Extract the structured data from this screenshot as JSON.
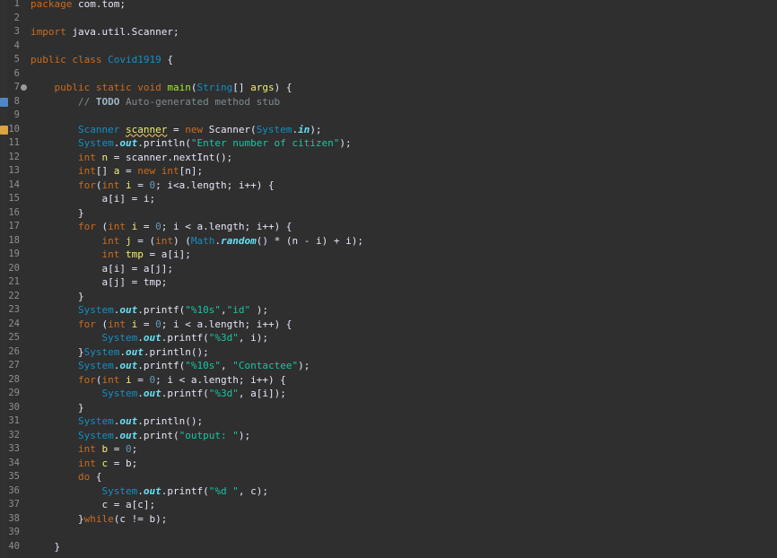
{
  "editor": {
    "language": "java",
    "lines": [
      {
        "n": "1",
        "tokens": [
          [
            "kw",
            "package"
          ],
          [
            "pln",
            " com.tom;"
          ]
        ]
      },
      {
        "n": "2",
        "tokens": []
      },
      {
        "n": "3",
        "tokens": [
          [
            "kw",
            "import"
          ],
          [
            "pln",
            " java.util.Scanner;"
          ]
        ]
      },
      {
        "n": "4",
        "tokens": []
      },
      {
        "n": "5",
        "tokens": [
          [
            "kw",
            "public"
          ],
          [
            "pln",
            " "
          ],
          [
            "kw",
            "class"
          ],
          [
            "pln",
            " "
          ],
          [
            "typ",
            "Covid1919"
          ],
          [
            "pln",
            " {"
          ]
        ]
      },
      {
        "n": "6",
        "tokens": []
      },
      {
        "n": "7",
        "tokens": [
          [
            "pln",
            "    "
          ],
          [
            "kw",
            "public"
          ],
          [
            "pln",
            " "
          ],
          [
            "kw",
            "static"
          ],
          [
            "pln",
            " "
          ],
          [
            "kw",
            "void"
          ],
          [
            "pln",
            " "
          ],
          [
            "mth",
            "main"
          ],
          [
            "pln",
            "("
          ],
          [
            "typ",
            "String"
          ],
          [
            "pln",
            "[] "
          ],
          [
            "var",
            "args"
          ],
          [
            "pln",
            ") {"
          ]
        ]
      },
      {
        "n": "8",
        "tokens": [
          [
            "pln",
            "        "
          ],
          [
            "cmt",
            "// "
          ],
          [
            "todo",
            "TODO"
          ],
          [
            "cmt",
            " Auto-generated method stub"
          ]
        ]
      },
      {
        "n": "9",
        "tokens": []
      },
      {
        "n": "10",
        "tokens": [
          [
            "pln",
            "        "
          ],
          [
            "typ",
            "Scanner"
          ],
          [
            "pln",
            " "
          ],
          [
            "warnvar",
            "scanner"
          ],
          [
            "pln",
            " = "
          ],
          [
            "kw",
            "new"
          ],
          [
            "pln",
            " Scanner("
          ],
          [
            "typ",
            "System"
          ],
          [
            "pln",
            "."
          ],
          [
            "fld",
            "in"
          ],
          [
            "pln",
            ");"
          ]
        ]
      },
      {
        "n": "11",
        "tokens": [
          [
            "pln",
            "        "
          ],
          [
            "typ",
            "System"
          ],
          [
            "pln",
            "."
          ],
          [
            "fld",
            "out"
          ],
          [
            "pln",
            ".println("
          ],
          [
            "str",
            "\"Enter number of citizen\""
          ],
          [
            "pln",
            ");"
          ]
        ]
      },
      {
        "n": "12",
        "tokens": [
          [
            "pln",
            "        "
          ],
          [
            "kw",
            "int"
          ],
          [
            "pln",
            " "
          ],
          [
            "var",
            "n"
          ],
          [
            "pln",
            " = scanner.nextInt();"
          ]
        ]
      },
      {
        "n": "13",
        "tokens": [
          [
            "pln",
            "        "
          ],
          [
            "kw",
            "int"
          ],
          [
            "pln",
            "[] "
          ],
          [
            "var",
            "a"
          ],
          [
            "pln",
            " = "
          ],
          [
            "kw",
            "new"
          ],
          [
            "pln",
            " "
          ],
          [
            "kw",
            "int"
          ],
          [
            "pln",
            "[n];"
          ]
        ]
      },
      {
        "n": "14",
        "tokens": [
          [
            "pln",
            "        "
          ],
          [
            "kw",
            "for"
          ],
          [
            "pln",
            "("
          ],
          [
            "kw",
            "int"
          ],
          [
            "pln",
            " "
          ],
          [
            "var",
            "i"
          ],
          [
            "pln",
            " = "
          ],
          [
            "num",
            "0"
          ],
          [
            "pln",
            "; i<a.length; i++) {"
          ]
        ]
      },
      {
        "n": "15",
        "tokens": [
          [
            "pln",
            "            a[i] = i;"
          ]
        ]
      },
      {
        "n": "16",
        "tokens": [
          [
            "pln",
            "        }"
          ]
        ]
      },
      {
        "n": "17",
        "tokens": [
          [
            "pln",
            "        "
          ],
          [
            "kw",
            "for"
          ],
          [
            "pln",
            " ("
          ],
          [
            "kw",
            "int"
          ],
          [
            "pln",
            " "
          ],
          [
            "var",
            "i"
          ],
          [
            "pln",
            " = "
          ],
          [
            "num",
            "0"
          ],
          [
            "pln",
            "; i < a.length; i++) {"
          ]
        ]
      },
      {
        "n": "18",
        "tokens": [
          [
            "pln",
            "            "
          ],
          [
            "kw",
            "int"
          ],
          [
            "pln",
            " "
          ],
          [
            "var",
            "j"
          ],
          [
            "pln",
            " = ("
          ],
          [
            "kw",
            "int"
          ],
          [
            "pln",
            ") ("
          ],
          [
            "typ",
            "Math"
          ],
          [
            "pln",
            "."
          ],
          [
            "fld",
            "random"
          ],
          [
            "pln",
            "() * (n - i) + i);"
          ]
        ]
      },
      {
        "n": "19",
        "tokens": [
          [
            "pln",
            "            "
          ],
          [
            "kw",
            "int"
          ],
          [
            "pln",
            " "
          ],
          [
            "var",
            "tmp"
          ],
          [
            "pln",
            " = a[i];"
          ]
        ]
      },
      {
        "n": "20",
        "tokens": [
          [
            "pln",
            "            a[i] = a[j];"
          ]
        ]
      },
      {
        "n": "21",
        "tokens": [
          [
            "pln",
            "            a[j] = tmp;"
          ]
        ]
      },
      {
        "n": "22",
        "tokens": [
          [
            "pln",
            "        }"
          ]
        ]
      },
      {
        "n": "23",
        "tokens": [
          [
            "pln",
            "        "
          ],
          [
            "typ",
            "System"
          ],
          [
            "pln",
            "."
          ],
          [
            "fld",
            "out"
          ],
          [
            "pln",
            ".printf("
          ],
          [
            "str",
            "\"%10s\""
          ],
          [
            "pln",
            ","
          ],
          [
            "str",
            "\"id\""
          ],
          [
            "pln",
            " );"
          ]
        ]
      },
      {
        "n": "24",
        "tokens": [
          [
            "pln",
            "        "
          ],
          [
            "kw",
            "for"
          ],
          [
            "pln",
            " ("
          ],
          [
            "kw",
            "int"
          ],
          [
            "pln",
            " "
          ],
          [
            "var",
            "i"
          ],
          [
            "pln",
            " = "
          ],
          [
            "num",
            "0"
          ],
          [
            "pln",
            "; i < a.length; i++) {"
          ]
        ]
      },
      {
        "n": "25",
        "tokens": [
          [
            "pln",
            "            "
          ],
          [
            "typ",
            "System"
          ],
          [
            "pln",
            "."
          ],
          [
            "fld",
            "out"
          ],
          [
            "pln",
            ".printf("
          ],
          [
            "str",
            "\"%3d\""
          ],
          [
            "pln",
            ", i);"
          ]
        ]
      },
      {
        "n": "26",
        "tokens": [
          [
            "pln",
            "        }"
          ],
          [
            "typ",
            "System"
          ],
          [
            "pln",
            "."
          ],
          [
            "fld",
            "out"
          ],
          [
            "pln",
            ".println();"
          ]
        ]
      },
      {
        "n": "27",
        "tokens": [
          [
            "pln",
            "        "
          ],
          [
            "typ",
            "System"
          ],
          [
            "pln",
            "."
          ],
          [
            "fld",
            "out"
          ],
          [
            "pln",
            ".printf("
          ],
          [
            "str",
            "\"%10s\""
          ],
          [
            "pln",
            ", "
          ],
          [
            "str",
            "\"Contactee\""
          ],
          [
            "pln",
            ");"
          ]
        ]
      },
      {
        "n": "28",
        "tokens": [
          [
            "pln",
            "        "
          ],
          [
            "kw",
            "for"
          ],
          [
            "pln",
            "("
          ],
          [
            "kw",
            "int"
          ],
          [
            "pln",
            " "
          ],
          [
            "var",
            "i"
          ],
          [
            "pln",
            " = "
          ],
          [
            "num",
            "0"
          ],
          [
            "pln",
            "; i < a.length; i++) {"
          ]
        ]
      },
      {
        "n": "29",
        "tokens": [
          [
            "pln",
            "            "
          ],
          [
            "typ",
            "System"
          ],
          [
            "pln",
            "."
          ],
          [
            "fld",
            "out"
          ],
          [
            "pln",
            ".printf("
          ],
          [
            "str",
            "\"%3d\""
          ],
          [
            "pln",
            ", a[i]);"
          ]
        ]
      },
      {
        "n": "30",
        "tokens": [
          [
            "pln",
            "        }"
          ]
        ]
      },
      {
        "n": "31",
        "tokens": [
          [
            "pln",
            "        "
          ],
          [
            "typ",
            "System"
          ],
          [
            "pln",
            "."
          ],
          [
            "fld",
            "out"
          ],
          [
            "pln",
            ".println();"
          ]
        ]
      },
      {
        "n": "32",
        "tokens": [
          [
            "pln",
            "        "
          ],
          [
            "typ",
            "System"
          ],
          [
            "pln",
            "."
          ],
          [
            "fld",
            "out"
          ],
          [
            "pln",
            ".print("
          ],
          [
            "str",
            "\"output: \""
          ],
          [
            "pln",
            ");"
          ]
        ]
      },
      {
        "n": "33",
        "tokens": [
          [
            "pln",
            "        "
          ],
          [
            "kw",
            "int"
          ],
          [
            "pln",
            " "
          ],
          [
            "var",
            "b"
          ],
          [
            "pln",
            " = "
          ],
          [
            "num",
            "0"
          ],
          [
            "pln",
            ";"
          ]
        ]
      },
      {
        "n": "34",
        "tokens": [
          [
            "pln",
            "        "
          ],
          [
            "kw",
            "int"
          ],
          [
            "pln",
            " "
          ],
          [
            "var",
            "c"
          ],
          [
            "pln",
            " = b;"
          ]
        ]
      },
      {
        "n": "35",
        "tokens": [
          [
            "pln",
            "        "
          ],
          [
            "kw",
            "do"
          ],
          [
            "pln",
            " {"
          ]
        ]
      },
      {
        "n": "36",
        "tokens": [
          [
            "pln",
            "            "
          ],
          [
            "typ",
            "System"
          ],
          [
            "pln",
            "."
          ],
          [
            "fld",
            "out"
          ],
          [
            "pln",
            ".printf("
          ],
          [
            "str",
            "\"%d \""
          ],
          [
            "pln",
            ", c);"
          ]
        ]
      },
      {
        "n": "37",
        "tokens": [
          [
            "pln",
            "            c = a[c];"
          ]
        ]
      },
      {
        "n": "38",
        "tokens": [
          [
            "pln",
            "        }"
          ],
          [
            "kw",
            "while"
          ],
          [
            "pln",
            "(c != b);"
          ]
        ]
      },
      {
        "n": "39",
        "tokens": []
      },
      {
        "n": "40",
        "tokens": [
          [
            "pln",
            "    }"
          ]
        ]
      }
    ],
    "gutter_markers": [
      {
        "line": "8",
        "kind": "task"
      },
      {
        "line": "10",
        "kind": "warning"
      }
    ],
    "fold_markers": [
      "7"
    ]
  },
  "colors": {
    "background": "#2f2f2f",
    "keyword": "#cc6c1d",
    "string": "#17c6a3",
    "type": "#1290c3",
    "field": "#66e1f8",
    "method": "#a7ec21",
    "comment": "#7d8c93",
    "variable": "#f3ec79",
    "line_number": "#8f8f8f"
  }
}
